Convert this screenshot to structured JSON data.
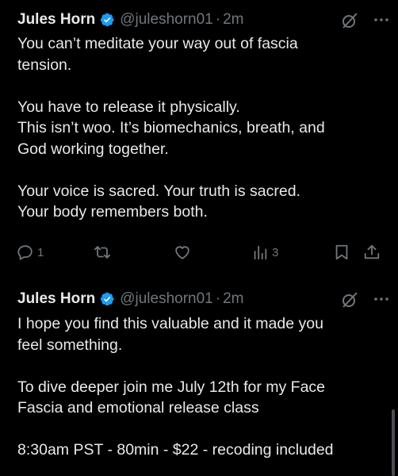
{
  "tweets": [
    {
      "author": {
        "name": "Jules Horn",
        "handle": "@juleshorn01",
        "time": "2m",
        "verified_color": "#1d9bf0"
      },
      "lines": [
        "You can’t meditate your way out of fascia",
        "tension.",
        "",
        "You have to release it physically.",
        "This isn’t woo. It’s biomechanics, breath, and",
        "God working together.",
        "",
        "Your voice is sacred. Your truth is sacred.",
        "Your body remembers both."
      ],
      "actions": {
        "replies": "1",
        "reposts": "",
        "likes": "",
        "views": "3"
      }
    },
    {
      "author": {
        "name": "Jules Horn",
        "handle": "@juleshorn01",
        "time": "2m",
        "verified_color": "#1d9bf0"
      },
      "lines": [
        "I hope you find this valuable and it made you",
        "feel something.",
        "",
        "To dive deeper join me July 12th for my Face",
        "Fascia and emotional release class",
        "",
        "8:30am PST - 80min - $22 - recoding included"
      ]
    }
  ],
  "separator": "·",
  "icons": {
    "grok": "grok-icon",
    "more": "more-icon",
    "reply": "reply-icon",
    "repost": "repost-icon",
    "like": "like-icon",
    "views": "views-icon",
    "bookmark": "bookmark-icon",
    "share": "share-icon"
  }
}
